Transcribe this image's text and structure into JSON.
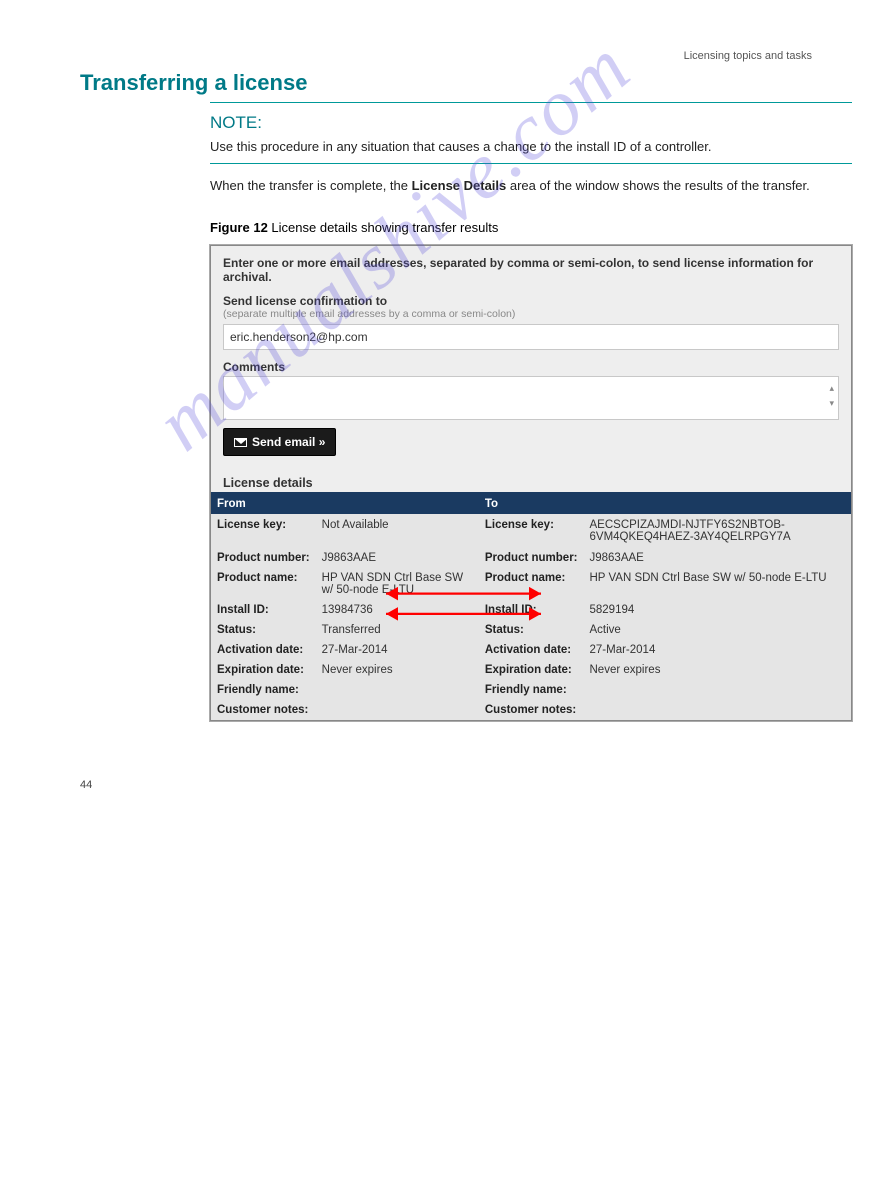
{
  "page_header": "Licensing topics and tasks",
  "page_title": "Transferring a license",
  "note_heading": "NOTE:",
  "note_text": "Use this procedure in any situation that causes a change to the install ID of a controller.",
  "paragraph1_prefix": "When the transfer is complete, the ",
  "paragraph1_strong": "License Details",
  "paragraph1_suffix": " area of the window shows the results of the transfer.",
  "figure_label": "Figure 12",
  "figure_title": "License details showing transfer results",
  "panel": {
    "intro": "Enter one or more email addresses, separated by comma or semi-colon, to send license information for archival.",
    "send_label": "Send license confirmation to",
    "send_help": "(separate multiple email addresses by a comma or semi-colon)",
    "email_value": "eric.henderson2@hp.com",
    "comments_label": "Comments",
    "send_email_btn": "Send email »",
    "license_details_heading": "License details",
    "col_from": "From",
    "col_to": "To",
    "rows": {
      "license_key_label": "License key:",
      "product_number_label": "Product number:",
      "product_name_label": "Product name:",
      "install_id_label": "Install ID:",
      "status_label": "Status:",
      "activation_date_label": "Activation date:",
      "expiration_date_label": "Expiration date:",
      "friendly_name_label": "Friendly name:",
      "customer_notes_label": "Customer notes:"
    },
    "from": {
      "license_key": "Not Available",
      "product_number": "J9863AAE",
      "product_name": "HP VAN SDN Ctrl Base SW w/ 50-node E-LTU",
      "install_id": "13984736",
      "status": "Transferred",
      "activation_date": "27-Mar-2014",
      "expiration_date": "Never expires",
      "friendly_name": "",
      "customer_notes": ""
    },
    "to": {
      "license_key": "AECSCPIZAJMDI-NJTFY6S2NBTOB-6VM4QKEQ4HAEZ-3AY4QELRPGY7A",
      "product_number": "J9863AAE",
      "product_name": "HP VAN SDN Ctrl Base SW w/ 50-node E-LTU",
      "install_id": "5829194",
      "status": "Active",
      "activation_date": "27-Mar-2014",
      "expiration_date": "Never expires",
      "friendly_name": "",
      "customer_notes": ""
    }
  },
  "footer": "44",
  "watermark": "manualshive.com"
}
